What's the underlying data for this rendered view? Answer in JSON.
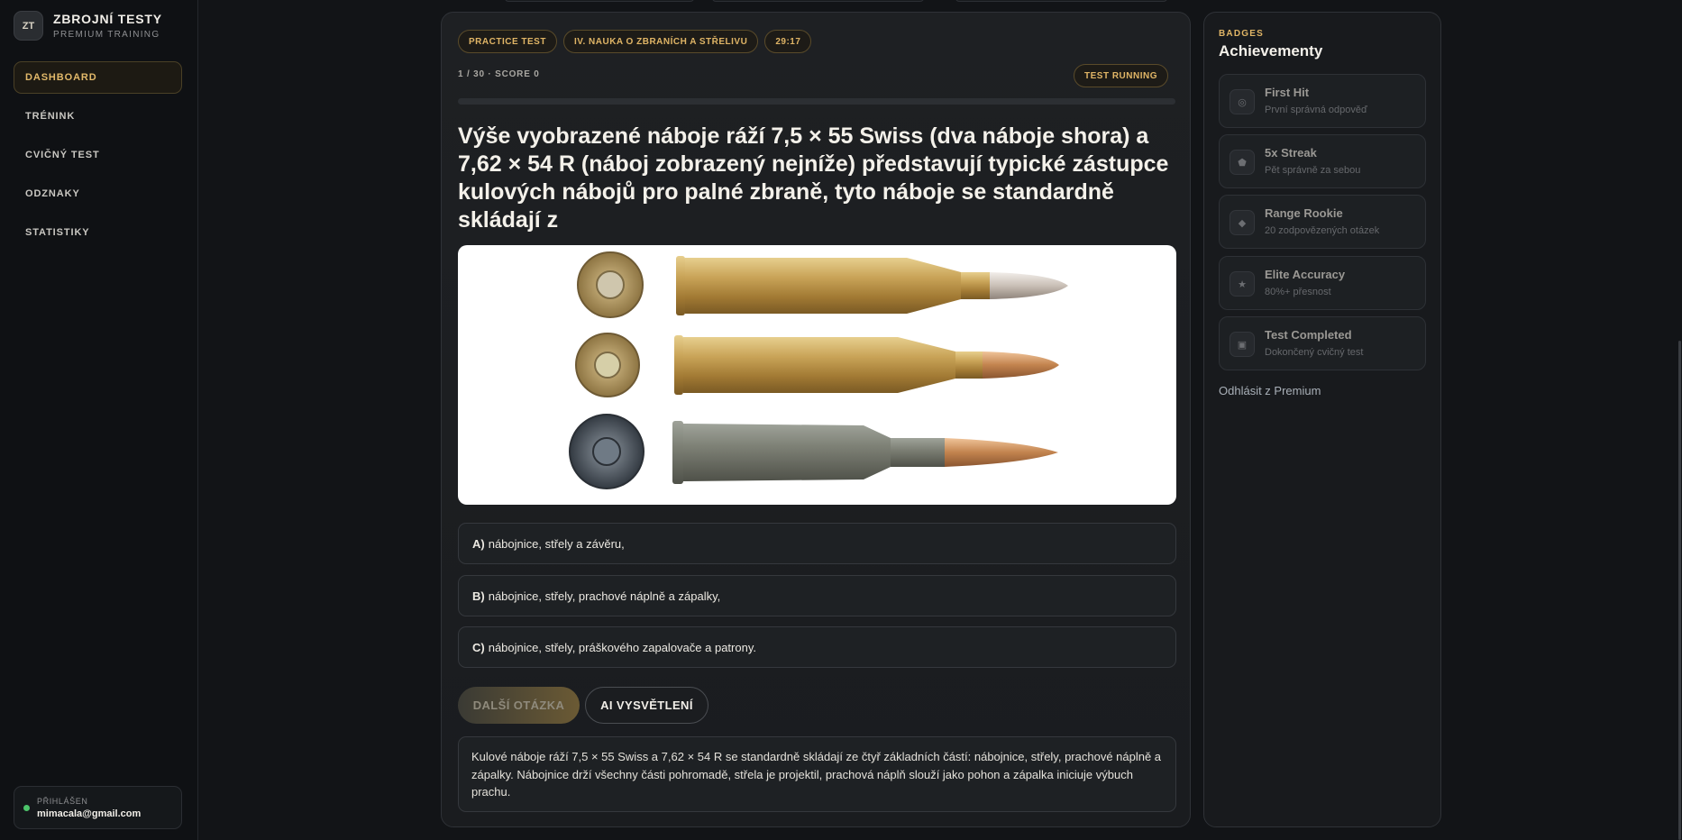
{
  "brand": {
    "logo": "ZT",
    "title": "ZBROJNÍ TESTY",
    "subtitle": "PREMIUM TRAINING"
  },
  "nav": {
    "items": [
      {
        "label": "DASHBOARD",
        "active": true
      },
      {
        "label": "TRÉNINK"
      },
      {
        "label": "CVIČNÝ TEST"
      },
      {
        "label": "ODZNAKY"
      },
      {
        "label": "STATISTIKY"
      }
    ]
  },
  "user": {
    "status_label": "PŘIHLÁŠEN",
    "email": "mimacala@gmail.com"
  },
  "test": {
    "pills": [
      "PRACTICE TEST",
      "IV. NAUKA O ZBRANÍCH A STŘELIVU",
      "29:17"
    ],
    "progress_text": "1 / 30 · SCORE 0",
    "status": "TEST RUNNING",
    "progress_fraction": 0.0,
    "question": "Výše vyobrazené náboje ráží 7,5 × 55 Swiss (dva náboje shora) a 7,62 × 54 R (náboj zobrazený nejníže) představují typické zástupce kulových nábojů pro palné zbraně, tyto náboje se standardně skládají z",
    "answers": [
      {
        "letter": "A)",
        "text": "nábojnice, střely a závěru,"
      },
      {
        "letter": "B)",
        "text": "nábojnice, střely, prachové náplně a zápalky,"
      },
      {
        "letter": "C)",
        "text": "nábojnice, střely, práškového zapalovače a patrony."
      }
    ],
    "next_button": "DALŠÍ OTÁZKA",
    "ai_button": "AI VYSVĚTLENÍ",
    "explanation": "Kulové náboje ráží 7,5 × 55 Swiss a 7,62 × 54 R se standardně skládají ze čtyř základních částí: nábojnice, střely, prachové náplně a zápalky. Nábojnice drží všechny části pohromadě, střela je projektil, prachová náplň slouží jako pohon a zápalka iniciuje výbuch prachu."
  },
  "badges": {
    "kicker": "BADGES",
    "title": "Achievementy",
    "items": [
      {
        "icon": "target-icon",
        "glyph": "◎",
        "title": "First Hit",
        "desc": "První správná odpověď"
      },
      {
        "icon": "streak-icon",
        "glyph": "⬟",
        "title": "5x Streak",
        "desc": "Pět správně za sebou"
      },
      {
        "icon": "rookie-icon",
        "glyph": "◆",
        "title": "Range Rookie",
        "desc": "20 zodpovězených otázek"
      },
      {
        "icon": "star-icon",
        "glyph": "★",
        "title": "Elite Accuracy",
        "desc": "80%+ přesnost"
      },
      {
        "icon": "completed-icon",
        "glyph": "▣",
        "title": "Test Completed",
        "desc": "Dokončený cvičný test"
      }
    ],
    "logout": "Odhlásit z Premium"
  }
}
